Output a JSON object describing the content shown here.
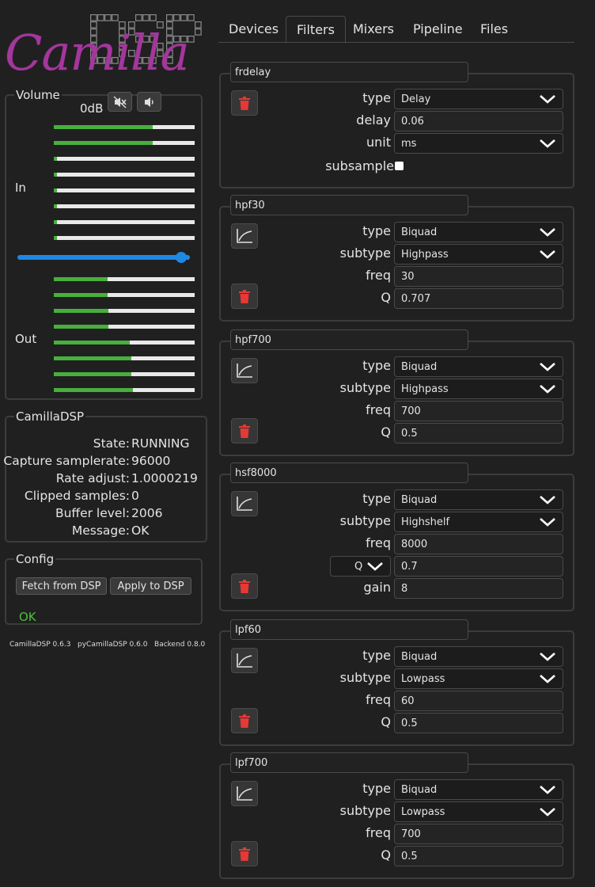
{
  "logo": {
    "text": "Camilla",
    "brand_color": "#a3379c"
  },
  "tabs": [
    "Devices",
    "Filters",
    "Mixers",
    "Pipeline",
    "Files"
  ],
  "volume": {
    "legend": "Volume",
    "db": "0dB",
    "in_label": "In",
    "out_label": "Out",
    "slider_level": 0.95,
    "in_levels": [
      0.7,
      0.7,
      0.02,
      0.02,
      0.02,
      0.02,
      0.02,
      0.02
    ],
    "out_levels": [
      0.38,
      0.38,
      0.39,
      0.39,
      0.54,
      0.55,
      0.55,
      0.56
    ]
  },
  "camilladsp": {
    "legend": "CamillaDSP",
    "rows": [
      {
        "k": "State:",
        "v": "RUNNING"
      },
      {
        "k": "Capture samplerate:",
        "v": "96000"
      },
      {
        "k": "Rate adjust:",
        "v": "1.0000219"
      },
      {
        "k": "Clipped samples:",
        "v": "0"
      },
      {
        "k": "Buffer level:",
        "v": "2006"
      },
      {
        "k": "Message:",
        "v": "OK"
      }
    ]
  },
  "config": {
    "legend": "Config",
    "fetch": "Fetch from DSP",
    "apply": "Apply to DSP",
    "status": "OK"
  },
  "versions": "CamillaDSP 0.6.3   pyCamillaDSP 0.6.0   Backend 0.8.0",
  "filters": [
    {
      "name": "frdelay",
      "rows": [
        {
          "label": "type",
          "value": "Delay",
          "select": true
        },
        {
          "label": "delay",
          "value": "0.06"
        },
        {
          "label": "unit",
          "value": "ms",
          "select": true
        },
        {
          "label": "subsample",
          "checkbox": true
        }
      ]
    },
    {
      "name": "hpf30",
      "rows": [
        {
          "label": "type",
          "value": "Biquad",
          "select": true
        },
        {
          "label": "subtype",
          "value": "Highpass",
          "select": true
        },
        {
          "label": "freq",
          "value": "30"
        },
        {
          "label": "Q",
          "value": "0.707"
        }
      ]
    },
    {
      "name": "hpf700",
      "rows": [
        {
          "label": "type",
          "value": "Biquad",
          "select": true
        },
        {
          "label": "subtype",
          "value": "Highpass",
          "select": true
        },
        {
          "label": "freq",
          "value": "700"
        },
        {
          "label": "Q",
          "value": "0.5"
        }
      ]
    },
    {
      "name": "hsf8000",
      "rows": [
        {
          "label": "type",
          "value": "Biquad",
          "select": true
        },
        {
          "label": "subtype",
          "value": "Highshelf",
          "select": true
        },
        {
          "label": "freq",
          "value": "8000"
        },
        {
          "label": "Q",
          "value": "0.7",
          "qselect": "Q"
        },
        {
          "label": "gain",
          "value": "8"
        }
      ]
    },
    {
      "name": "lpf60",
      "rows": [
        {
          "label": "type",
          "value": "Biquad",
          "select": true
        },
        {
          "label": "subtype",
          "value": "Lowpass",
          "select": true
        },
        {
          "label": "freq",
          "value": "60"
        },
        {
          "label": "Q",
          "value": "0.5"
        }
      ]
    },
    {
      "name": "lpf700",
      "rows": [
        {
          "label": "type",
          "value": "Biquad",
          "select": true
        },
        {
          "label": "subtype",
          "value": "Lowpass",
          "select": true
        },
        {
          "label": "freq",
          "value": "700"
        },
        {
          "label": "Q",
          "value": "0.5"
        }
      ]
    }
  ]
}
